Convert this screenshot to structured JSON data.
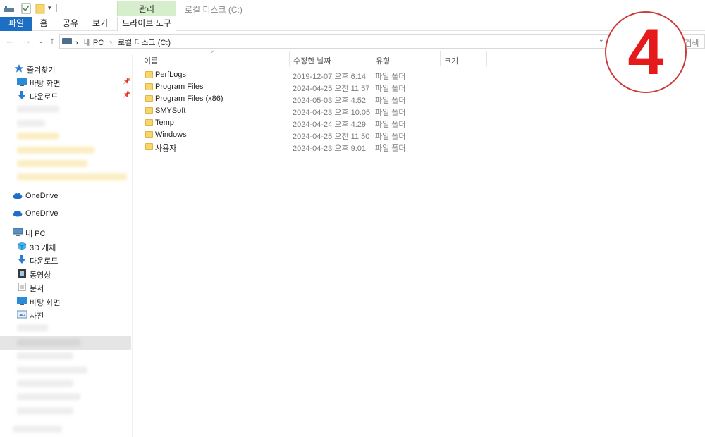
{
  "window": {
    "title": "로컬 디스크 (C:)",
    "context_tab_title": "관리"
  },
  "ribbon": {
    "tabs": [
      "파일",
      "홈",
      "공유",
      "보기",
      "드라이브 도구"
    ]
  },
  "address": {
    "crumbs": [
      "내 PC",
      "›",
      "로컬 디스크 (C:)"
    ],
    "search_placeholder": "로컬 디스크 (C:) 검색"
  },
  "sidebar": {
    "quick_access": "즐겨찾기",
    "quick_items": [
      "바탕 화면",
      "다운로드"
    ],
    "onedrive": [
      "OneDrive",
      "OneDrive"
    ],
    "this_pc": "내 PC",
    "pc_items": [
      "3D 개체",
      "다운로드",
      "동영상",
      "문서",
      "바탕 화면",
      "사진"
    ]
  },
  "columns": {
    "name": "이름",
    "modified": "수정한 날짜",
    "type": "유형",
    "size": "크기"
  },
  "files": [
    {
      "name": "PerfLogs",
      "modified": "2019-12-07 오후 6:14",
      "type": "파일 폴더"
    },
    {
      "name": "Program Files",
      "modified": "2024-04-25 오전 11:57",
      "type": "파일 폴더"
    },
    {
      "name": "Program Files (x86)",
      "modified": "2024-05-03 오후 4:52",
      "type": "파일 폴더"
    },
    {
      "name": "SMYSoft",
      "modified": "2024-04-23 오후 10:05",
      "type": "파일 폴더"
    },
    {
      "name": "Temp",
      "modified": "2024-04-24 오후 4:29",
      "type": "파일 폴더"
    },
    {
      "name": "Windows",
      "modified": "2024-04-25 오전 11:50",
      "type": "파일 폴더"
    },
    {
      "name": "사용자",
      "modified": "2024-04-23 오후 9:01",
      "type": "파일 폴더"
    }
  ],
  "overlay": {
    "step_number": "4"
  },
  "colors": {
    "file_tab": "#1d6fc4",
    "context_tab": "#d6eecb",
    "folder": "#f7d66e",
    "badge": "#e51b1b"
  }
}
